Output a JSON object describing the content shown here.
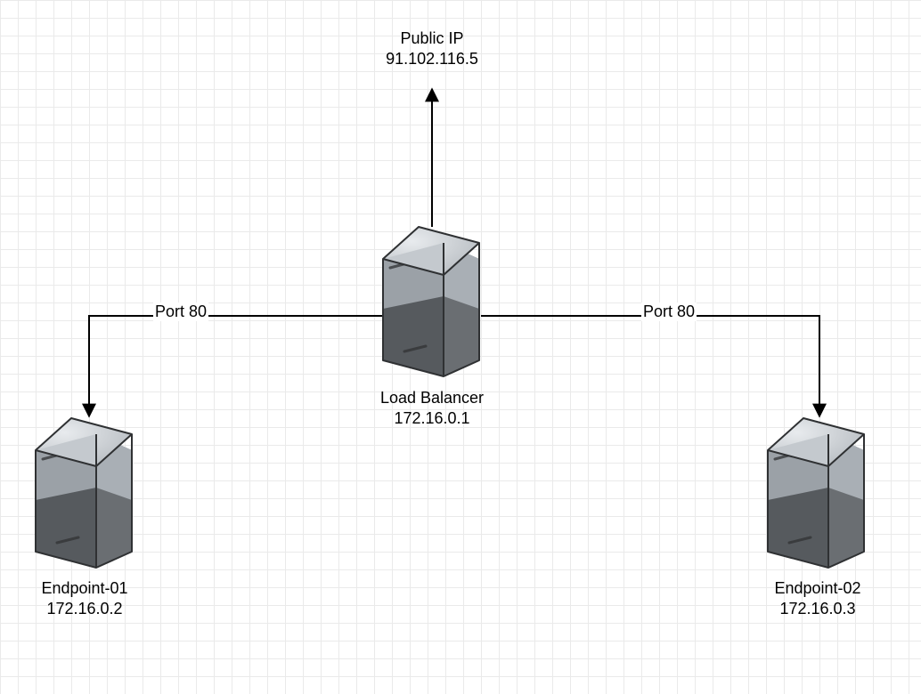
{
  "public_ip": {
    "title": "Public IP",
    "address": "91.102.116.5"
  },
  "load_balancer": {
    "title": "Load Balancer",
    "address": "172.16.0.1"
  },
  "endpoint1": {
    "title": "Endpoint-01",
    "address": "172.16.0.2"
  },
  "endpoint2": {
    "title": "Endpoint-02",
    "address": "172.16.0.3"
  },
  "edges": {
    "left_port": "Port 80",
    "right_port": "Port 80"
  }
}
